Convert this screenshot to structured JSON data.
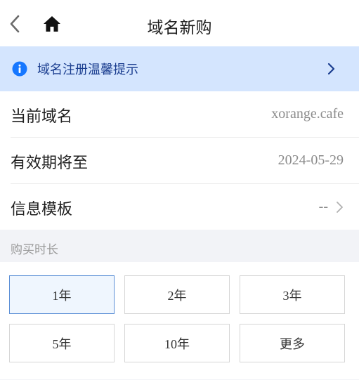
{
  "header": {
    "title": "域名新购",
    "back_icon": "chevron-left-icon",
    "home_icon": "home-icon"
  },
  "notice": {
    "text": "域名注册温馨提示",
    "icon": "info-icon",
    "accent_color": "#1677ff",
    "background_color": "#d4e5fe"
  },
  "details": [
    {
      "label": "当前域名",
      "value": "xorange.cafe"
    },
    {
      "label": "有效期将至",
      "value": "2024-05-29"
    },
    {
      "label": "信息模板",
      "value": "--"
    }
  ],
  "duration": {
    "section_label": "购买时长",
    "options": [
      "1年",
      "2年",
      "3年",
      "5年",
      "10年",
      "更多"
    ],
    "selected": "1年"
  }
}
